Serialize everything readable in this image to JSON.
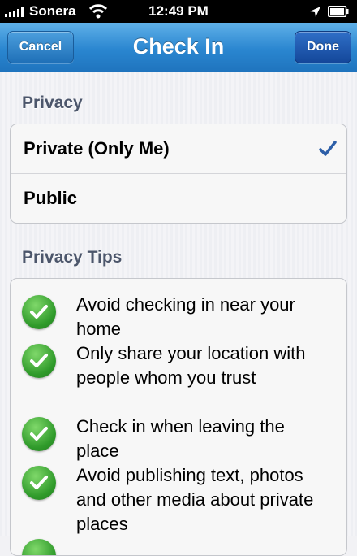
{
  "status_bar": {
    "carrier": "Sonera",
    "time": "12:49 PM"
  },
  "nav": {
    "title": "Check In",
    "cancel_label": "Cancel",
    "done_label": "Done"
  },
  "privacy": {
    "header": "Privacy",
    "options": [
      {
        "label": "Private (Only Me)",
        "selected": true
      },
      {
        "label": "Public",
        "selected": false
      }
    ]
  },
  "tips": {
    "header": "Privacy Tips",
    "items": [
      {
        "text": "Avoid checking in near your home"
      },
      {
        "text": "Only share your location with people whom you trust"
      },
      {
        "text": "Check in when leaving the place"
      },
      {
        "text": "Avoid publishing text, photos and other media about private places"
      }
    ]
  },
  "colors": {
    "nav_blue": "#2a86d0",
    "check_blue": "#2d5fa8",
    "tip_green": "#2f9a2a"
  }
}
